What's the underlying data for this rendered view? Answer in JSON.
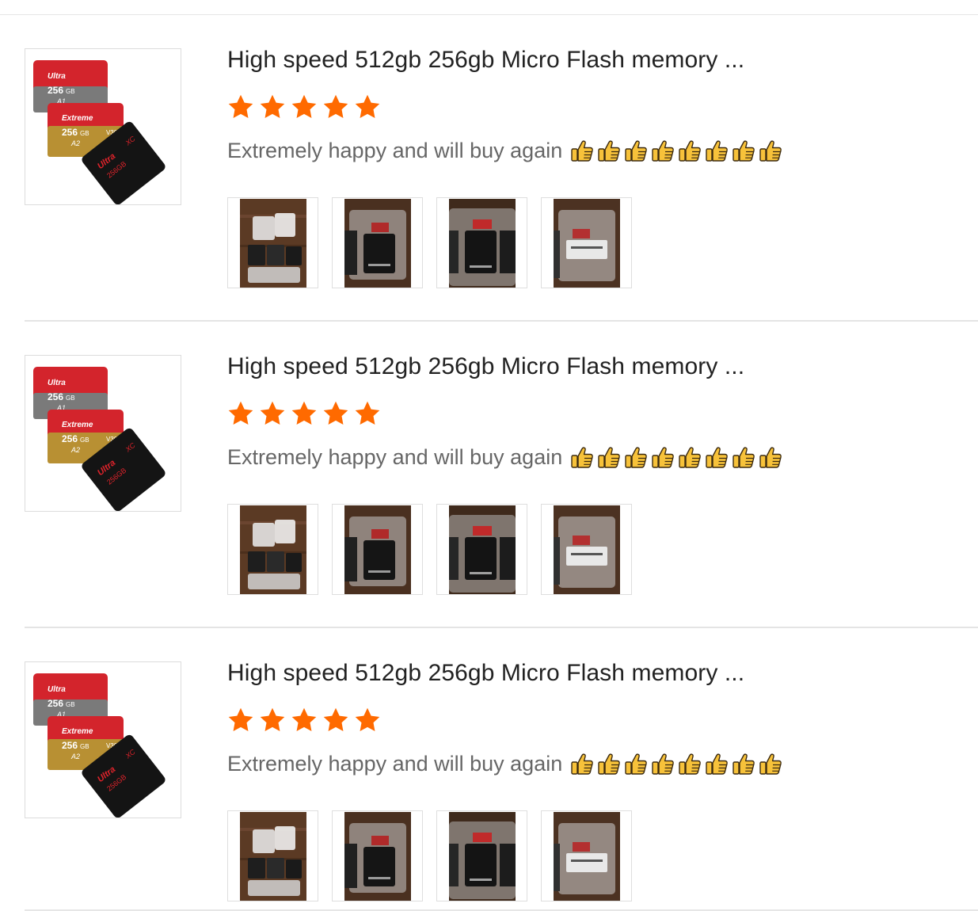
{
  "colors": {
    "star": "#ff6a00",
    "divider": "#e4e4e4",
    "title": "#222222",
    "comment": "#666666"
  },
  "reviews": [
    {
      "product_title": "High speed 512gb 256gb Micro Flash memory ...",
      "rating": 5,
      "rating_max": 5,
      "comment": "Extremely happy and will buy again",
      "emoji_icon": "thumbs-up-icon",
      "emoji_count": 8,
      "product_image": {
        "card_front": {
          "brand": "Ultra",
          "capacity": "256",
          "unit": "GB",
          "mark": "A1"
        },
        "card_middle": {
          "brand": "Extreme",
          "capacity": "256",
          "unit": "GB",
          "mark": "A2",
          "speed": "V30"
        },
        "card_back": {
          "brand": "Ultra",
          "capacity": "256GB",
          "mark": "XC"
        }
      },
      "photos": [
        "photo-1",
        "photo-2",
        "photo-3",
        "photo-4"
      ]
    },
    {
      "product_title": "High speed 512gb 256gb Micro Flash memory ...",
      "rating": 5,
      "rating_max": 5,
      "comment": "Extremely happy and will buy again",
      "emoji_icon": "thumbs-up-icon",
      "emoji_count": 8,
      "product_image": {
        "card_front": {
          "brand": "Ultra",
          "capacity": "256",
          "unit": "GB",
          "mark": "A1"
        },
        "card_middle": {
          "brand": "Extreme",
          "capacity": "256",
          "unit": "GB",
          "mark": "A2",
          "speed": "V30"
        },
        "card_back": {
          "brand": "Ultra",
          "capacity": "256GB",
          "mark": "XC"
        }
      },
      "photos": [
        "photo-1",
        "photo-2",
        "photo-3",
        "photo-4"
      ]
    },
    {
      "product_title": "High speed 512gb 256gb Micro Flash memory ...",
      "rating": 5,
      "rating_max": 5,
      "comment": "Extremely happy and will buy again",
      "emoji_icon": "thumbs-up-icon",
      "emoji_count": 8,
      "product_image": {
        "card_front": {
          "brand": "Ultra",
          "capacity": "256",
          "unit": "GB",
          "mark": "A1"
        },
        "card_middle": {
          "brand": "Extreme",
          "capacity": "256",
          "unit": "GB",
          "mark": "A2",
          "speed": "V30"
        },
        "card_back": {
          "brand": "Ultra",
          "capacity": "256GB",
          "mark": "XC"
        }
      },
      "photos": [
        "photo-1",
        "photo-2",
        "photo-3",
        "photo-4"
      ]
    }
  ]
}
